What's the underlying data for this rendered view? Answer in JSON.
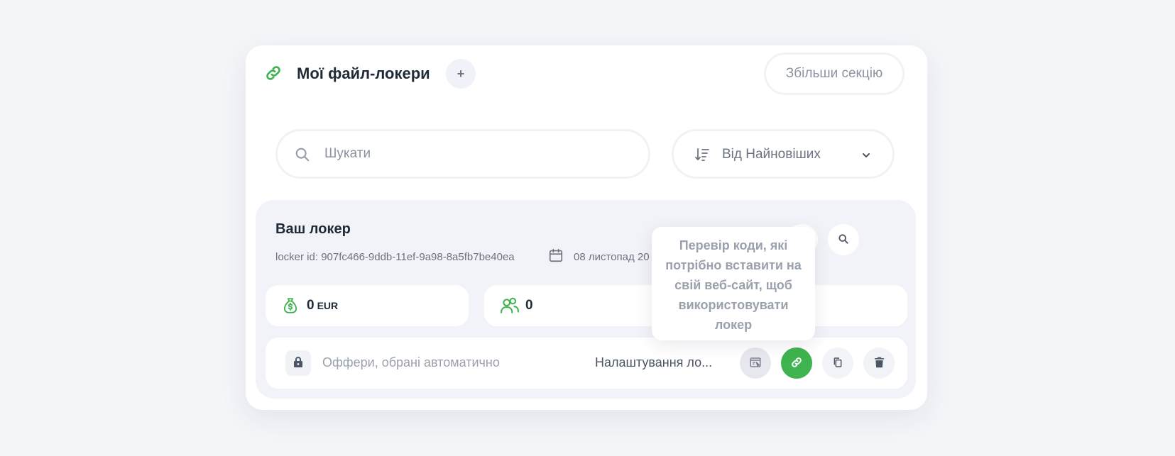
{
  "header": {
    "title": "Мої файл-локери",
    "add_label": "+",
    "expand_label": "Збільши секцію"
  },
  "search": {
    "placeholder": "Шукати",
    "value": ""
  },
  "sort": {
    "selected": "Від Найновіших"
  },
  "locker": {
    "title": "Ваш локер",
    "id_text": "locker id: 907fc466-9ddb-11ef-9a98-8a5fb7be40ea",
    "date": "08 листопад 20",
    "earnings_value": "0",
    "earnings_currency": "EUR",
    "users_value": "0",
    "offers_text": "Оффери, обрані автоматично",
    "settings_text": "Налаштування ло..."
  },
  "tooltip": {
    "text": "Перевір коди, які потрібно вставити на свій веб-сайт, щоб використовувати локер"
  },
  "colors": {
    "accent": "#3fb34f",
    "text_dark": "#1f2a37",
    "text_muted": "#8b93a1",
    "page_bg": "#f4f5f9"
  },
  "icons": {
    "header": "link-icon",
    "search": "search-icon",
    "sort": "sort-icon",
    "sort_chevron": "chevron-down-icon",
    "calendar": "calendar-icon",
    "edit": "pencil-icon",
    "view": "search-icon",
    "earnings": "money-bag-icon",
    "users": "users-icon",
    "lock": "lock-icon",
    "embed": "code-window-icon",
    "link": "link-icon",
    "copy": "copy-icon",
    "delete": "trash-icon"
  }
}
